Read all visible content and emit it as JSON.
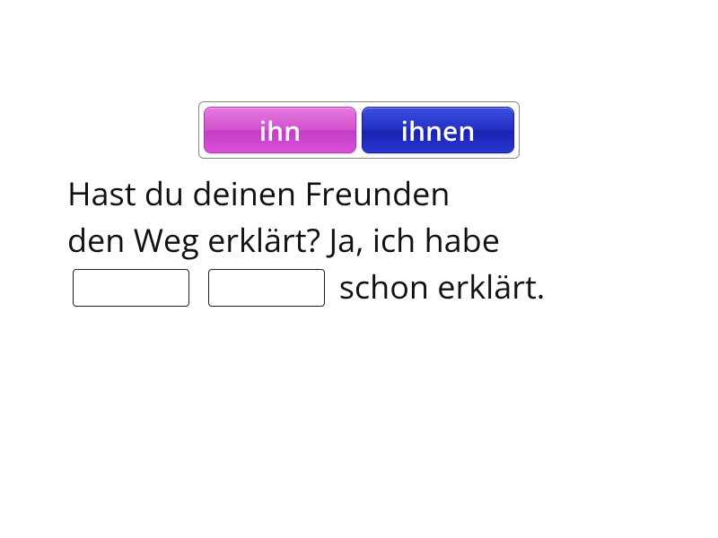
{
  "tray": {
    "tiles": [
      {
        "label": "ihn",
        "color": "pink"
      },
      {
        "label": "ihnen",
        "color": "blue"
      }
    ]
  },
  "sentence": {
    "tokens": [
      {
        "type": "text",
        "value": "Hast"
      },
      {
        "type": "text",
        "value": "du"
      },
      {
        "type": "text",
        "value": "deinen"
      },
      {
        "type": "text",
        "value": "Freunden"
      },
      {
        "type": "break"
      },
      {
        "type": "text",
        "value": "den"
      },
      {
        "type": "text",
        "value": "Weg"
      },
      {
        "type": "text",
        "value": "erklärt?"
      },
      {
        "type": "text",
        "value": " Ja,"
      },
      {
        "type": "text",
        "value": "ich"
      },
      {
        "type": "text",
        "value": "habe"
      },
      {
        "type": "break"
      },
      {
        "type": "blank"
      },
      {
        "type": "blank"
      },
      {
        "type": "text",
        "value": " schon"
      },
      {
        "type": "text",
        "value": "erklärt."
      }
    ]
  }
}
